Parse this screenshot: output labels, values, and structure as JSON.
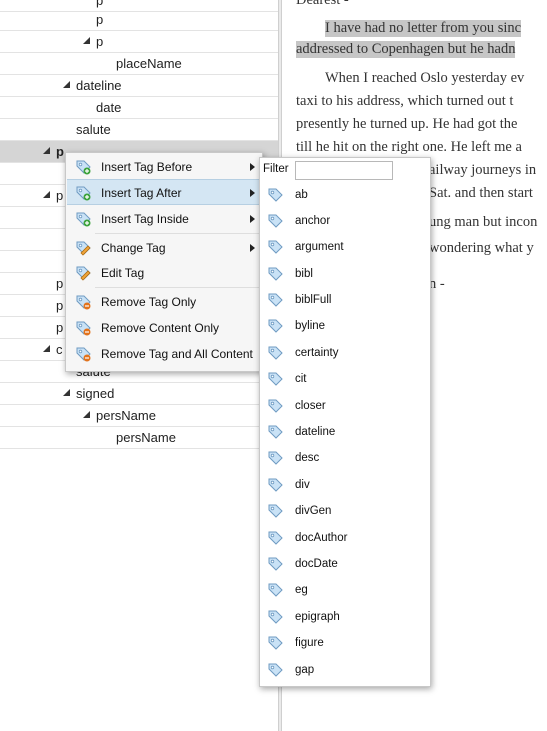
{
  "tree": {
    "rows": [
      {
        "label": "p"
      },
      {
        "label": "p"
      },
      {
        "label": "p"
      },
      {
        "label": "placeName"
      },
      {
        "label": "dateline"
      },
      {
        "label": "date"
      },
      {
        "label": "salute"
      },
      {
        "label": "p"
      },
      {
        "label": ""
      },
      {
        "label": "p"
      },
      {
        "label": ""
      },
      {
        "label": ""
      },
      {
        "label": ""
      },
      {
        "label": "p"
      },
      {
        "label": "p"
      },
      {
        "label": "p"
      },
      {
        "label": "c"
      },
      {
        "label": "salute"
      },
      {
        "label": "signed"
      },
      {
        "label": "persName"
      },
      {
        "label": "persName"
      }
    ]
  },
  "preview": {
    "lines": [
      "Dearest -",
      "I have had no letter from you sinc",
      "addressed to Copenhagen but he hadn",
      "When I reached Oslo yesterday ev",
      "taxi to his address, which turned out t",
      "presently he turned up. He had got the",
      "till he hit on the right one. He left me a",
      "ailway journeys in",
      "Sat. and then start",
      "ung man but incon",
      "wondering what y",
      "n -"
    ]
  },
  "context_menu": {
    "items": [
      {
        "label": "Insert Tag Before",
        "icon": "tag-insert-icon"
      },
      {
        "label": "Insert Tag After",
        "icon": "tag-insert-icon"
      },
      {
        "label": "Insert Tag Inside",
        "icon": "tag-insert-icon"
      },
      {
        "label": "Change Tag",
        "icon": "tag-edit-icon"
      },
      {
        "label": "Edit Tag",
        "icon": "tag-edit-icon"
      },
      {
        "label": "Remove Tag Only",
        "icon": "tag-remove-icon"
      },
      {
        "label": "Remove Content Only",
        "icon": "tag-remove-icon"
      },
      {
        "label": "Remove Tag and All Content",
        "icon": "tag-remove-icon"
      }
    ]
  },
  "submenu": {
    "filter_label": "Filter",
    "filter_value": "",
    "tags": [
      "ab",
      "anchor",
      "argument",
      "bibl",
      "biblFull",
      "byline",
      "certainty",
      "cit",
      "closer",
      "dateline",
      "desc",
      "div",
      "divGen",
      "docAuthor",
      "docDate",
      "eg",
      "epigraph",
      "figure",
      "gap"
    ]
  },
  "colors": {
    "selection_highlight": "#d5d5d5",
    "menu_active": "#d4e6f3",
    "text_highlight": "#c6c6c6"
  }
}
